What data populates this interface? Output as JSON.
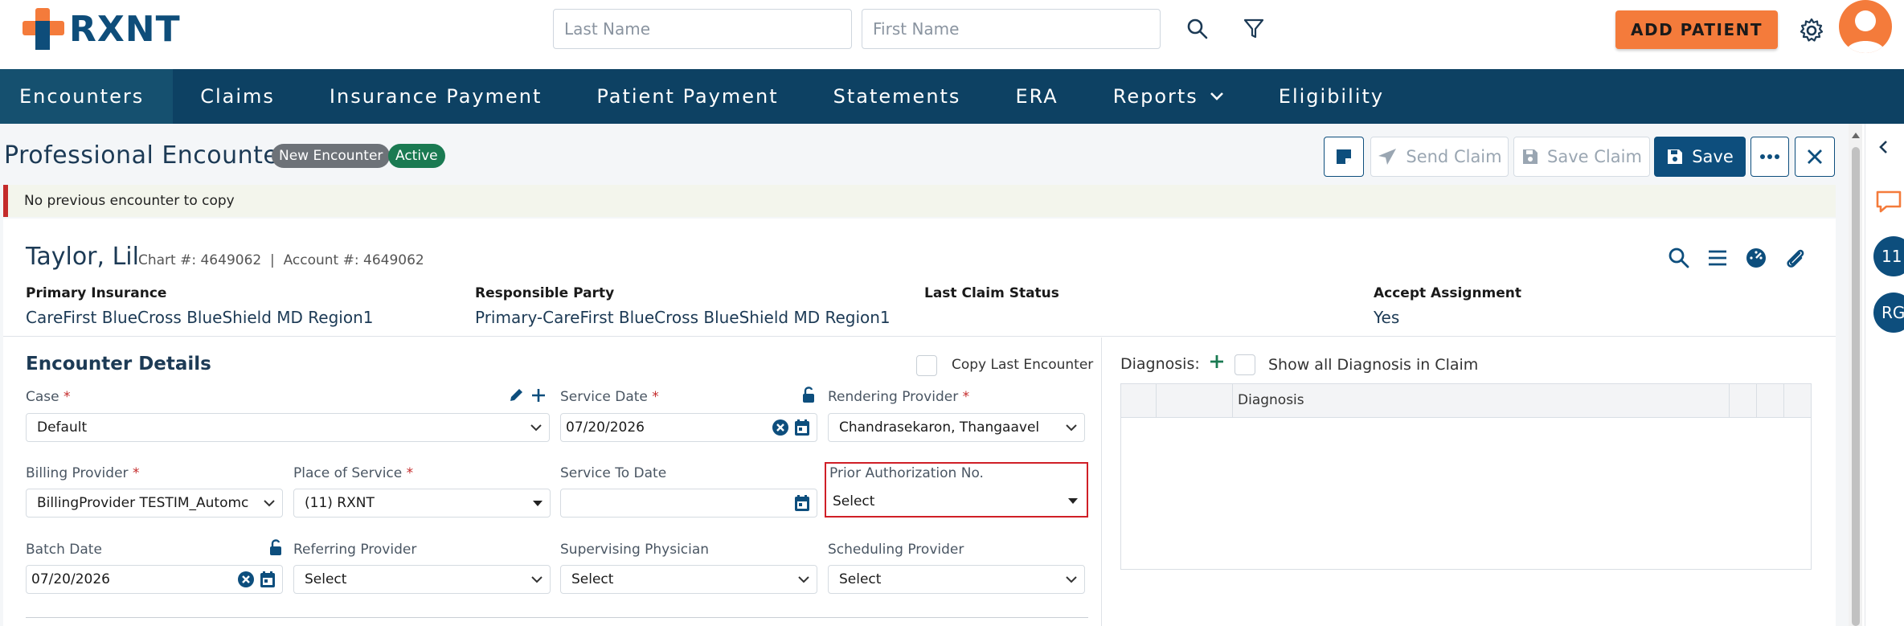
{
  "header": {
    "logo_text": "RXNT",
    "search": {
      "last_name_placeholder": "Last Name",
      "first_name_placeholder": "First Name"
    },
    "add_patient_label": "ADD PATIENT"
  },
  "nav": {
    "items": [
      {
        "label": "Encounters"
      },
      {
        "label": "Claims"
      },
      {
        "label": "Insurance Payment"
      },
      {
        "label": "Patient Payment"
      },
      {
        "label": "Statements"
      },
      {
        "label": "ERA"
      },
      {
        "label": "Reports"
      },
      {
        "label": "Eligibility"
      }
    ]
  },
  "page": {
    "title": "Professional Encounter",
    "badges": {
      "status1": "New Encounter",
      "status2": "Active"
    },
    "toolbar": {
      "send_claim": "Send Claim",
      "save_claim": "Save Claim",
      "save": "Save"
    },
    "banner": "No previous encounter to copy"
  },
  "patient": {
    "name": "Taylor, Lil",
    "chart": "Chart #: 4649062",
    "account": "Account #: 4649062",
    "primary_insurance_label": "Primary Insurance",
    "primary_insurance_value": "CareFirst BlueCross BlueShield MD Region1",
    "responsible_party_label": "Responsible Party",
    "responsible_party_value": "Primary-CareFirst BlueCross BlueShield MD Region1",
    "last_claim_status_label": "Last Claim Status",
    "accept_assignment_label": "Accept Assignment",
    "accept_assignment_value": "Yes"
  },
  "encounter": {
    "section_title": "Encounter Details",
    "copy_last_label": "Copy Last Encounter",
    "case_label": "Case",
    "case_value": "Default",
    "service_date_label": "Service Date",
    "service_date_value": "07/20/2026",
    "rendering_provider_label": "Rendering Provider",
    "rendering_provider_value": "Chandrasekaron, Thangaavel",
    "billing_provider_label": "Billing Provider",
    "billing_provider_value": "BillingProvider TESTIM_Automc",
    "place_of_service_label": "Place of Service",
    "place_of_service_value": "(11) RXNT",
    "service_to_date_label": "Service To Date",
    "prior_auth_label": "Prior Authorization No.",
    "prior_auth_value": "Select",
    "batch_date_label": "Batch Date",
    "batch_date_value": "07/20/2026",
    "referring_provider_label": "Referring Provider",
    "referring_provider_value": "Select",
    "supervising_physician_label": "Supervising Physician",
    "supervising_physician_value": "Select",
    "scheduling_provider_label": "Scheduling Provider",
    "scheduling_provider_value": "Select",
    "required_mark": "*"
  },
  "diagnosis": {
    "label": "Diagnosis:",
    "show_all_label": "Show all Diagnosis in Claim",
    "column_header": "Diagnosis"
  },
  "rail": {
    "badge1": "11",
    "badge2": "RG"
  },
  "colors": {
    "brand_navy": "#0d4163",
    "accent_orange": "#f47b3b",
    "required_red": "#c42b2b",
    "active_green": "#1a7a52"
  }
}
